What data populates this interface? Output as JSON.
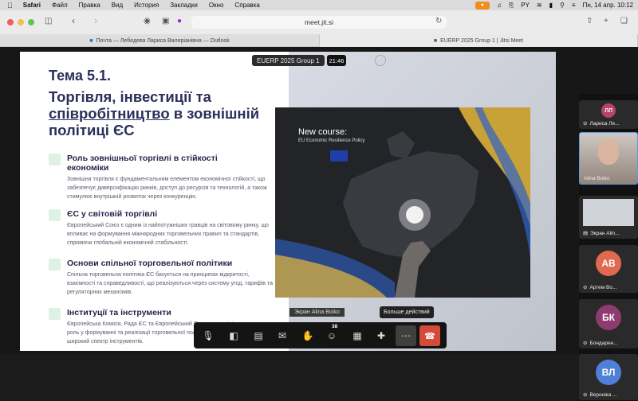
{
  "menubar": {
    "app": "Safari",
    "items": [
      "Файл",
      "Правка",
      "Вид",
      "История",
      "Закладки",
      "Окно",
      "Справка"
    ],
    "keyboard": "PY",
    "datetime": "Пн, 14 апр.  10:12"
  },
  "browser": {
    "url": "meet.jit.si",
    "tabs": [
      {
        "label": "Почта — Лебедева Лариса Валеріанівна — Outlook"
      },
      {
        "label": "EUERP 2025 Group 1 | Jitsi Meet"
      }
    ]
  },
  "slide": {
    "topic": "Тема 5.1.",
    "title_part1": "Торгівля, інвестиції та",
    "title_underlined": "співробітництво",
    "title_part2": " в зовнішній політиці ЄС",
    "sections": [
      {
        "heading": "Роль зовнішньої торгівлі в стійкості економіки",
        "text": "Зовнішня торгівля є фундаментальним елементом економічної стійкості, що забезпечує диверсифікацію ринків, доступ до ресурсів та технологій, а також стимулює внутрішній розвиток через конкуренцію."
      },
      {
        "heading": "ЄС у світовій торгівлі",
        "text": "Європейський Союз є одним із найпотужніших гравців на світовому ринку, що впливає на формування міжнародних торговельних правил та стандартів, сприяючи глобальній економічній стабільності."
      },
      {
        "heading": "Основи спільної торговельної політики",
        "text": "Спільна торговельна політика ЄС базується на принципах відкритості, взаємності та справедливості, що реалізуються через систему угод, тарифів та регуляторних механізмів."
      },
      {
        "heading": "Інституції та інструменти",
        "text": "Європейська Комісія, Рада ЄС та Європейський Парламент відіграють ключову роль у формуванні та реалізації торговельної політики ЄС, використовуючи широкий спектр інструментів."
      }
    ],
    "image": {
      "line1": "New course:",
      "line2": "EU Economic Resilience Policy"
    }
  },
  "meeting": {
    "title": "EUERP 2025 Group 1",
    "timer": "21:46",
    "participants_count": "38",
    "screen_label": "Экран Alina Boiko",
    "tooltip": "Больше действий",
    "raise_hand_count": "38"
  },
  "participants": [
    {
      "initials": "ЛЛ",
      "name": "Лариса Ле...",
      "color": "#b5436a"
    },
    {
      "initials": "",
      "name": "Alina Boiko",
      "color": "#9a8c84"
    },
    {
      "initials": "",
      "name": "Экран Alin...",
      "color": "#555"
    },
    {
      "initials": "АВ",
      "name": "Артем Во...",
      "color": "#e0694f"
    },
    {
      "initials": "БК",
      "name": "Бондарен...",
      "color": "#8e3b6f"
    },
    {
      "initials": "ВЛ",
      "name": "Вероніка ...",
      "color": "#4f7fd6"
    }
  ]
}
